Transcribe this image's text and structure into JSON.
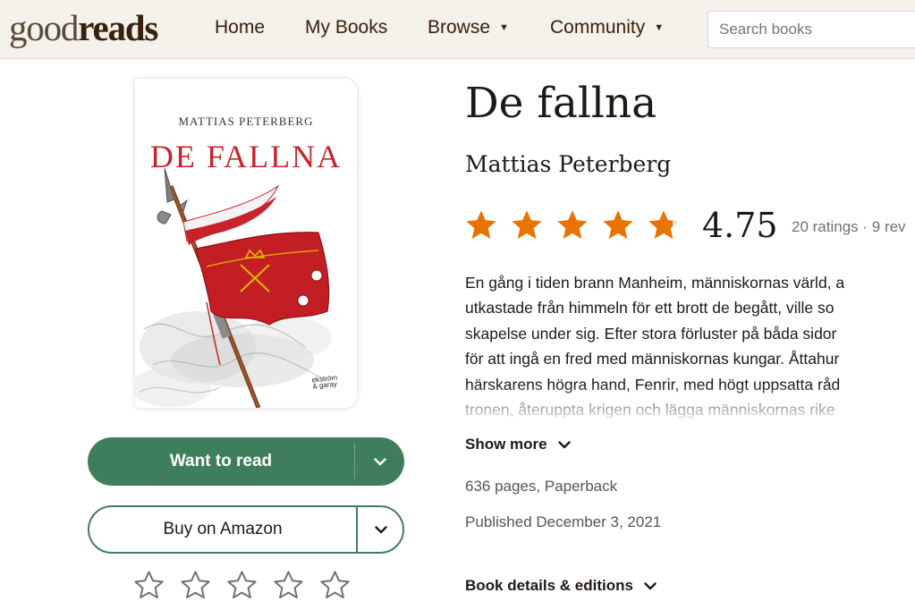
{
  "header": {
    "logo_light": "good",
    "logo_bold": "reads",
    "nav": [
      {
        "label": "Home",
        "has_dropdown": false
      },
      {
        "label": "My Books",
        "has_dropdown": false
      },
      {
        "label": "Browse",
        "has_dropdown": true
      },
      {
        "label": "Community",
        "has_dropdown": true
      }
    ],
    "caret_glyph": "▼",
    "search_placeholder": "Search books"
  },
  "book": {
    "cover": {
      "author": "MATTIAS PETERBERG",
      "title": "DE FALLNA",
      "publisher_line1": "ekström",
      "publisher_line2": "& garay"
    },
    "title": "De fallna",
    "author": "Mattias Peterberg",
    "rating_average": "4.75",
    "rating_value": 4.75,
    "ratings_meta": "20 ratings · 9 rev",
    "description_lines": [
      "En gång i tiden brann Manheim, människornas värld, a",
      "utkastade från himmeln för ett brott de begått, ville so",
      "skapelse under sig. Efter stora förluster på båda sidor",
      "för att ingå en fred med människornas kungar. Åttahur",
      "härskarens högra hand, Fenrir, med högt uppsatta råd",
      "tronen, återuppta krigen och lägga människornas rike"
    ],
    "show_more": "Show more",
    "pages_format": "636 pages, Paperback",
    "published": "Published December 3, 2021",
    "details_link": "Book details & editions"
  },
  "actions": {
    "want_to_read": "Want to read",
    "buy": "Buy on Amazon",
    "rate_star_count": 5
  },
  "colors": {
    "header_bg": "#f4f1ea",
    "logo": "#382110",
    "primary_green": "#3f7e5d",
    "star_orange": "#e87400",
    "cover_red": "#c6232a"
  },
  "icons": {
    "chevron": "chevron-down-icon",
    "star_filled": "star-filled-icon",
    "star_outline": "star-outline-icon"
  }
}
